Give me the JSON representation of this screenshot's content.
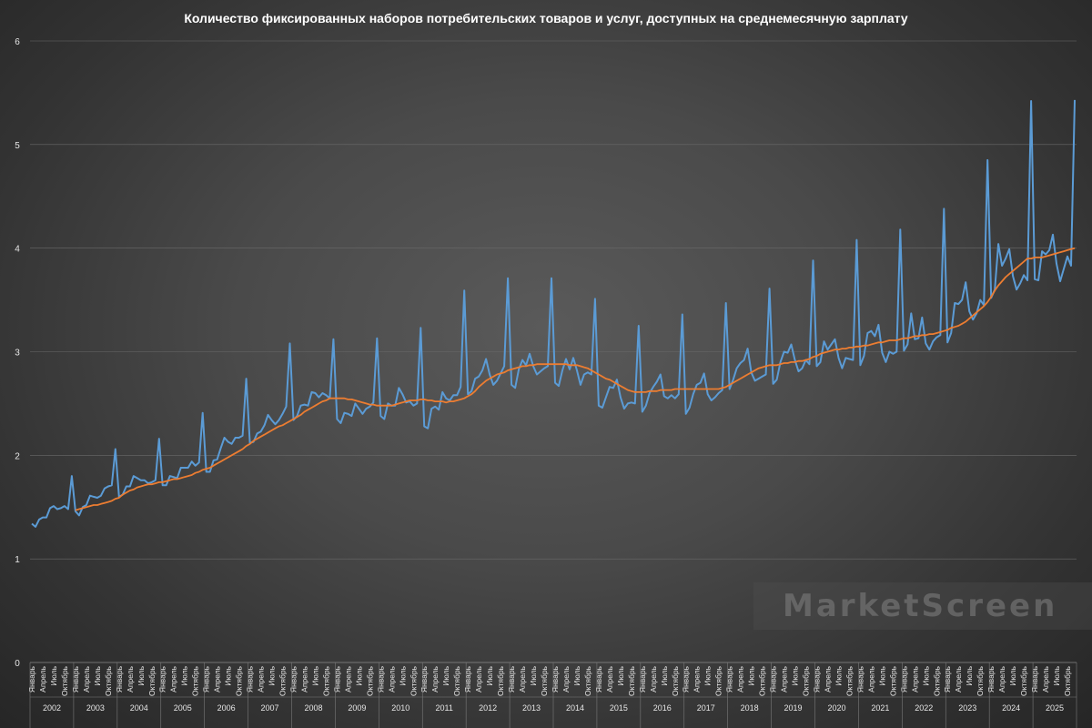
{
  "chart_data": {
    "type": "line",
    "title": "Количество фиксированных наборов потребительских товаров и услуг, доступных на среднемесячную зарплату",
    "xlabel": "",
    "ylabel": "",
    "ylim": [
      0,
      6
    ],
    "yticks": [
      "0",
      "1",
      "2",
      "3",
      "4",
      "5",
      "6"
    ],
    "grid": true,
    "legend": "none",
    "month_tick_labels": [
      "Январь",
      "Апрель",
      "Июль",
      "Октябрь"
    ],
    "years": [
      "2002",
      "2003",
      "2004",
      "2005",
      "2006",
      "2007",
      "2008",
      "2009",
      "2010",
      "2011",
      "2012",
      "2013",
      "2014",
      "2015",
      "2016",
      "2017",
      "2018",
      "2019",
      "2020",
      "2021",
      "2022",
      "2023",
      "2024",
      "2025"
    ],
    "colors": {
      "monthly": "#5b9bd5",
      "trend": "#ed7d31"
    },
    "series": [
      {
        "values": [
          1.34,
          1.31,
          1.38,
          1.4,
          1.4,
          1.49,
          1.51,
          1.48,
          1.49,
          1.51,
          1.48,
          1.8,
          1.46,
          1.42,
          1.5,
          1.52,
          1.61,
          1.6,
          1.59,
          1.61,
          1.68,
          1.7,
          1.71,
          2.06,
          1.6,
          1.62,
          1.7,
          1.7,
          1.8,
          1.78,
          1.76,
          1.76,
          1.73,
          1.74,
          1.76,
          2.16,
          1.71,
          1.71,
          1.8,
          1.79,
          1.78,
          1.88,
          1.88,
          1.88,
          1.94,
          1.9,
          1.93,
          2.41,
          1.84,
          1.84,
          1.95,
          1.96,
          2.07,
          2.17,
          2.13,
          2.11,
          2.17,
          2.17,
          2.19,
          2.74,
          2.12,
          2.13,
          2.21,
          2.23,
          2.29,
          2.39,
          2.34,
          2.3,
          2.34,
          2.4,
          2.47,
          3.08,
          2.34,
          2.38,
          2.48,
          2.49,
          2.48,
          2.61,
          2.6,
          2.56,
          2.6,
          2.58,
          2.55,
          3.12,
          2.35,
          2.31,
          2.41,
          2.4,
          2.38,
          2.5,
          2.45,
          2.4,
          2.45,
          2.47,
          2.51,
          3.13,
          2.38,
          2.35,
          2.5,
          2.48,
          2.48,
          2.65,
          2.59,
          2.51,
          2.52,
          2.48,
          2.5,
          3.23,
          2.28,
          2.26,
          2.45,
          2.47,
          2.44,
          2.61,
          2.55,
          2.53,
          2.58,
          2.58,
          2.66,
          3.59,
          2.59,
          2.62,
          2.74,
          2.76,
          2.82,
          2.93,
          2.78,
          2.68,
          2.72,
          2.79,
          2.86,
          3.71,
          2.68,
          2.65,
          2.83,
          2.92,
          2.87,
          2.98,
          2.86,
          2.78,
          2.81,
          2.84,
          2.86,
          3.71,
          2.7,
          2.67,
          2.82,
          2.93,
          2.83,
          2.94,
          2.82,
          2.68,
          2.78,
          2.8,
          2.78,
          3.51,
          2.48,
          2.46,
          2.56,
          2.66,
          2.65,
          2.73,
          2.56,
          2.45,
          2.5,
          2.51,
          2.5,
          3.25,
          2.42,
          2.48,
          2.6,
          2.66,
          2.71,
          2.78,
          2.57,
          2.55,
          2.58,
          2.55,
          2.59,
          3.36,
          2.4,
          2.46,
          2.59,
          2.68,
          2.7,
          2.79,
          2.59,
          2.53,
          2.56,
          2.6,
          2.63,
          3.47,
          2.64,
          2.73,
          2.84,
          2.89,
          2.92,
          3.03,
          2.8,
          2.72,
          2.74,
          2.76,
          2.78,
          3.61,
          2.69,
          2.73,
          2.9,
          3.0,
          2.99,
          3.07,
          2.92,
          2.81,
          2.84,
          2.92,
          2.88,
          3.88,
          2.86,
          2.9,
          3.1,
          3.02,
          3.07,
          3.12,
          2.94,
          2.84,
          2.94,
          2.93,
          2.92,
          4.08,
          2.87,
          2.96,
          3.18,
          3.2,
          3.15,
          3.26,
          2.99,
          2.9,
          3.0,
          2.98,
          3.0,
          4.18,
          3.01,
          3.07,
          3.37,
          3.12,
          3.13,
          3.33,
          3.08,
          3.02,
          3.1,
          3.14,
          3.16,
          4.38,
          3.09,
          3.18,
          3.47,
          3.46,
          3.5,
          3.67,
          3.39,
          3.31,
          3.37,
          3.5,
          3.45,
          4.85,
          3.52,
          3.6,
          4.04,
          3.83,
          3.9,
          3.99,
          3.73,
          3.6,
          3.66,
          3.74,
          3.69,
          5.42,
          3.7,
          3.69,
          3.97,
          3.94,
          3.98,
          4.13,
          3.85,
          3.68,
          3.8,
          3.92,
          3.83,
          5.43
        ]
      },
      {
        "values": [
          null,
          null,
          null,
          null,
          null,
          null,
          null,
          null,
          null,
          null,
          null,
          null,
          1.47,
          1.48,
          1.49,
          1.5,
          1.51,
          1.52,
          1.52,
          1.53,
          1.54,
          1.55,
          1.56,
          1.58,
          1.59,
          1.62,
          1.64,
          1.66,
          1.67,
          1.69,
          1.7,
          1.71,
          1.72,
          1.72,
          1.73,
          1.74,
          1.74,
          1.75,
          1.76,
          1.77,
          1.77,
          1.78,
          1.79,
          1.8,
          1.81,
          1.83,
          1.84,
          1.86,
          1.87,
          1.88,
          1.9,
          1.92,
          1.94,
          1.96,
          1.98,
          2.0,
          2.02,
          2.04,
          2.06,
          2.09,
          2.11,
          2.14,
          2.16,
          2.18,
          2.2,
          2.22,
          2.24,
          2.26,
          2.28,
          2.29,
          2.31,
          2.33,
          2.35,
          2.37,
          2.39,
          2.42,
          2.44,
          2.46,
          2.48,
          2.5,
          2.52,
          2.53,
          2.55,
          2.55,
          2.55,
          2.55,
          2.55,
          2.54,
          2.54,
          2.53,
          2.52,
          2.51,
          2.5,
          2.49,
          2.49,
          2.48,
          2.48,
          2.48,
          2.48,
          2.48,
          2.49,
          2.5,
          2.51,
          2.52,
          2.53,
          2.53,
          2.53,
          2.54,
          2.54,
          2.53,
          2.53,
          2.52,
          2.52,
          2.52,
          2.51,
          2.52,
          2.52,
          2.53,
          2.54,
          2.55,
          2.57,
          2.59,
          2.62,
          2.66,
          2.69,
          2.72,
          2.74,
          2.76,
          2.78,
          2.79,
          2.8,
          2.82,
          2.83,
          2.84,
          2.85,
          2.86,
          2.86,
          2.87,
          2.87,
          2.88,
          2.88,
          2.88,
          2.88,
          2.88,
          2.88,
          2.88,
          2.88,
          2.88,
          2.87,
          2.87,
          2.87,
          2.86,
          2.85,
          2.84,
          2.82,
          2.8,
          2.78,
          2.76,
          2.74,
          2.73,
          2.71,
          2.69,
          2.67,
          2.65,
          2.63,
          2.62,
          2.61,
          2.61,
          2.61,
          2.61,
          2.62,
          2.62,
          2.62,
          2.63,
          2.63,
          2.63,
          2.63,
          2.64,
          2.64,
          2.64,
          2.64,
          2.64,
          2.64,
          2.64,
          2.64,
          2.64,
          2.64,
          2.64,
          2.64,
          2.64,
          2.65,
          2.66,
          2.68,
          2.7,
          2.72,
          2.74,
          2.76,
          2.78,
          2.8,
          2.82,
          2.84,
          2.85,
          2.86,
          2.87,
          2.87,
          2.87,
          2.88,
          2.89,
          2.89,
          2.9,
          2.9,
          2.91,
          2.91,
          2.92,
          2.93,
          2.95,
          2.96,
          2.98,
          2.99,
          3.0,
          3.01,
          3.02,
          3.02,
          3.03,
          3.03,
          3.04,
          3.04,
          3.05,
          3.05,
          3.06,
          3.06,
          3.07,
          3.08,
          3.09,
          3.09,
          3.1,
          3.11,
          3.11,
          3.11,
          3.12,
          3.13,
          3.13,
          3.14,
          3.15,
          3.15,
          3.16,
          3.16,
          3.17,
          3.17,
          3.18,
          3.19,
          3.2,
          3.21,
          3.23,
          3.24,
          3.25,
          3.27,
          3.29,
          3.32,
          3.35,
          3.38,
          3.41,
          3.44,
          3.48,
          3.53,
          3.59,
          3.64,
          3.68,
          3.72,
          3.75,
          3.78,
          3.81,
          3.84,
          3.87,
          3.9,
          3.9,
          3.91,
          3.91,
          3.91,
          3.92,
          3.93,
          3.94,
          3.95,
          3.96,
          3.97,
          3.98,
          3.99,
          4.0
        ]
      }
    ]
  }
}
